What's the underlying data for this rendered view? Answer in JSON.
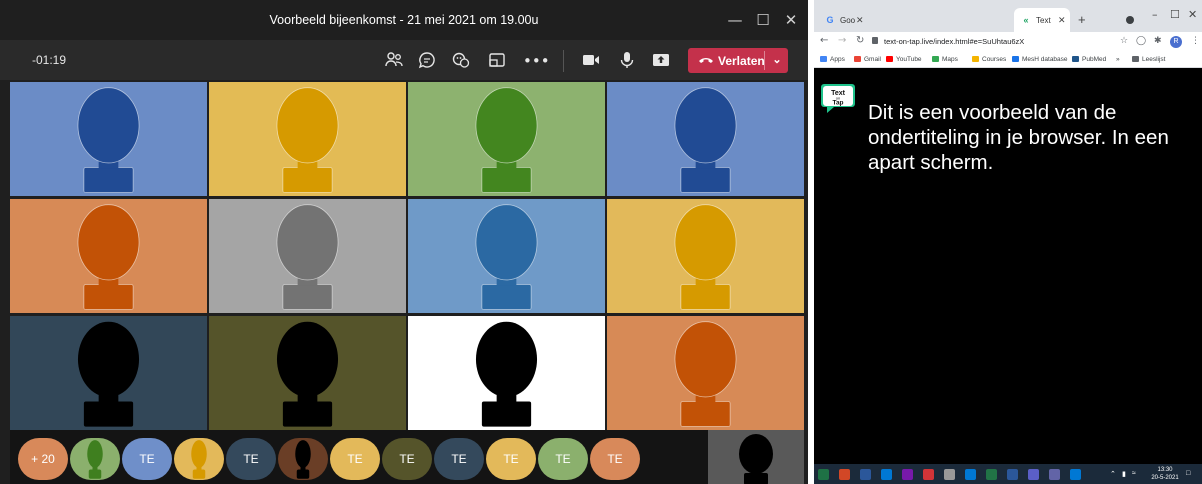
{
  "teams": {
    "title": "Voorbeeld bijeenkomst - 21 mei 2021 om 19.00u",
    "timer": "-01:19",
    "more_label": "•••",
    "leave_label": "Verlaten",
    "leave_color": "#c4314b",
    "controls": [
      "people-icon",
      "chat-icon",
      "reactions-icon",
      "rooms-icon",
      "more-icon",
      "camera-icon",
      "mic-icon",
      "share-icon"
    ],
    "window_controls": {
      "minimize": "—",
      "maximize": "☐",
      "close": "✕"
    }
  },
  "grid": {
    "tiles": [
      {
        "bg": "#6b8cc6",
        "fg": "#214b94"
      },
      {
        "bg": "#e3bb55",
        "fg": "#d69a00"
      },
      {
        "bg": "#8db26f",
        "fg": "#43861f"
      },
      {
        "bg": "#6b8cc6",
        "fg": "#214b94"
      },
      {
        "bg": "#d78a56",
        "fg": "#c25206"
      },
      {
        "bg": "#a5a5a5",
        "fg": "#737373"
      },
      {
        "bg": "#6f9ac8",
        "fg": "#2b69a3"
      },
      {
        "bg": "#e2b95a",
        "fg": "#d69a00"
      },
      {
        "bg": "#324758",
        "fg": "#000000"
      },
      {
        "bg": "#55542a",
        "fg": "#000000"
      },
      {
        "bg": "#ffffff",
        "fg": "#000000"
      },
      {
        "bg": "#d78a56",
        "fg": "#c25206"
      }
    ]
  },
  "strip": {
    "chips": [
      {
        "label": "+ 20",
        "bg": "#d8895a",
        "avatar": false
      },
      {
        "label": "",
        "bg": "#8bb06d",
        "avatar": true,
        "fg": "#3f7f1f"
      },
      {
        "label": "TE",
        "bg": "#6f8fc9",
        "avatar": false
      },
      {
        "label": "",
        "bg": "#e3b95a",
        "avatar": true,
        "fg": "#d69a00"
      },
      {
        "label": "TE",
        "bg": "#34495c",
        "avatar": false
      },
      {
        "label": "",
        "bg": "#6a3e26",
        "avatar": true,
        "fg": "#000000"
      },
      {
        "label": "TE",
        "bg": "#e3b95a",
        "avatar": false
      },
      {
        "label": "TE",
        "bg": "#55542a",
        "avatar": false
      },
      {
        "label": "TE",
        "bg": "#34495c",
        "avatar": false
      },
      {
        "label": "TE",
        "bg": "#e3b95a",
        "avatar": false
      },
      {
        "label": "TE",
        "bg": "#8bb06d",
        "avatar": false
      },
      {
        "label": "TE",
        "bg": "#d8895a",
        "avatar": false
      }
    ],
    "selfview_bg": "#595959"
  },
  "chrome": {
    "tab1": {
      "label": "Goo",
      "favicon": "G"
    },
    "tab2": {
      "label": "Text",
      "favicon": "«"
    },
    "new_tab": "+",
    "url": "text-on-tap.live/index.html#e=SuUhtau6zX",
    "bookmarks": [
      {
        "label": "Apps",
        "color": "#4285f4"
      },
      {
        "label": "Gmail",
        "color": "#ea4335"
      },
      {
        "label": "YouTube",
        "color": "#ff0000"
      },
      {
        "label": "Maps",
        "color": "#34a853"
      },
      {
        "label": "Courses",
        "color": "#f4b400"
      },
      {
        "label": "MesH database",
        "color": "#1a73e8"
      },
      {
        "label": "PubMed",
        "color": "#20558a"
      },
      {
        "label": "»",
        "color": "#ffffff"
      },
      {
        "label": "Leeslijst",
        "color": "#5f6368"
      }
    ],
    "avatar_letter": "R",
    "window_controls": {
      "minimize": "–",
      "maximize": "☐",
      "close": "✕"
    }
  },
  "page": {
    "logo_text_1": "Text",
    "logo_text_2": "on",
    "logo_text_3": "Tap",
    "caption": "Dit is een voorbeeld van de ondertiteling in je browser. In een apart scherm."
  },
  "taskbar": {
    "time": "13:30",
    "date": "20-5-2021",
    "icons": [
      "#1e7145",
      "#d24726",
      "#2b579a",
      "#0078d4",
      "#7719aa",
      "#d13438",
      "#999999",
      "#0078d4",
      "#217346",
      "#2b579a",
      "#5b5fc7",
      "#6264a7",
      "#0078d4"
    ]
  }
}
